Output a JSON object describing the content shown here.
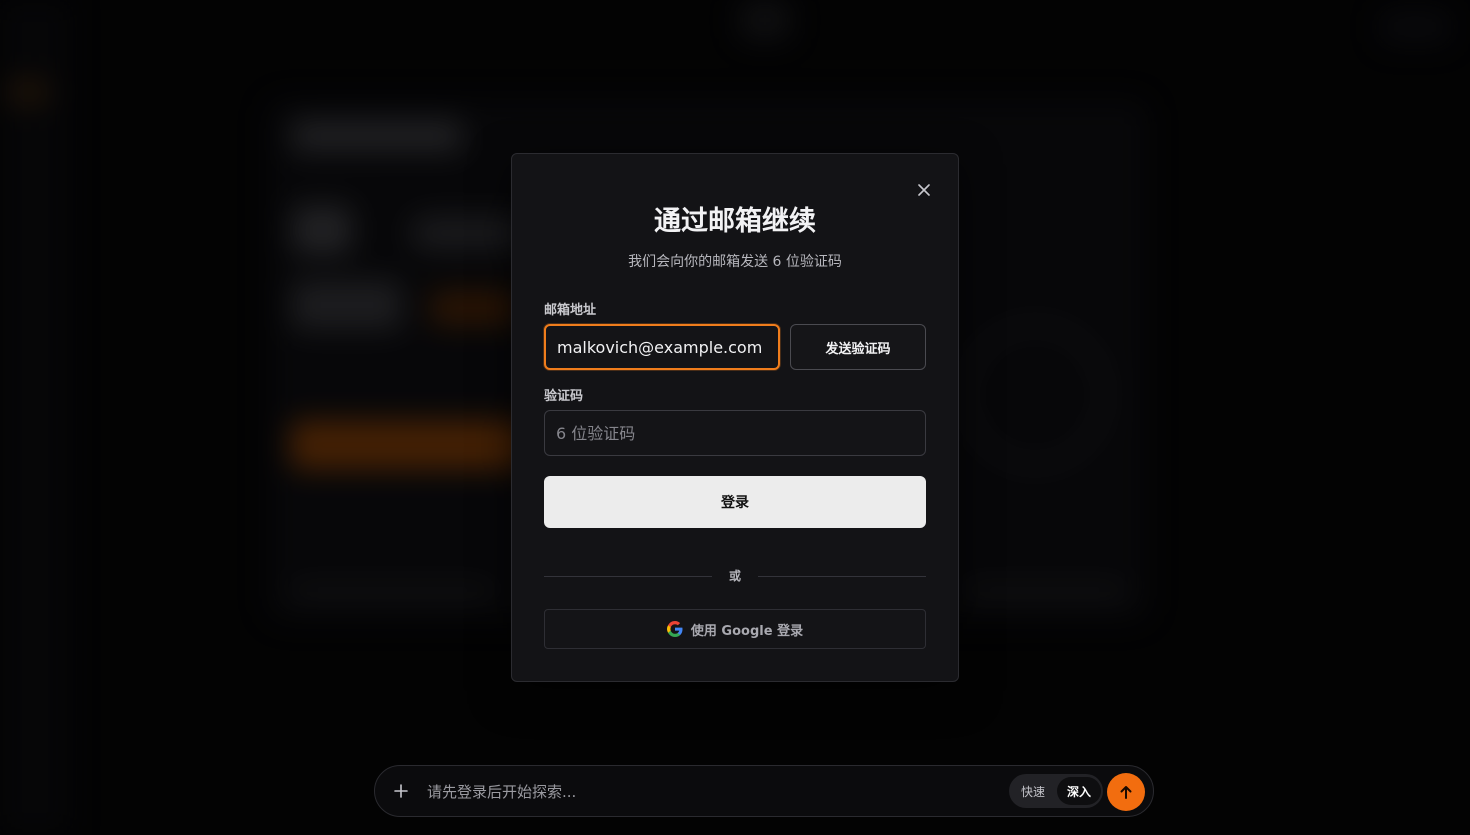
{
  "modal": {
    "title": "通过邮箱继续",
    "subtitle": "我们会向你的邮箱发送 6 位验证码",
    "email_label": "邮箱地址",
    "email_value": "malkovich@example.com",
    "send_code_label": "发送验证码",
    "code_label": "验证码",
    "code_placeholder": "6 位验证码",
    "login_label": "登录",
    "divider_text": "或",
    "google_label": "使用 Google 登录"
  },
  "composer": {
    "placeholder": "请先登录后开始探索...",
    "mode_fast": "快速",
    "mode_deep": "深入"
  },
  "icons": {
    "close": "close-icon",
    "google": "google-icon",
    "plus": "plus-icon",
    "send": "arrow-up-icon"
  },
  "colors": {
    "accent": "#f26d0f",
    "focus_border": "#f07d1c",
    "login_button": "#ececec"
  }
}
